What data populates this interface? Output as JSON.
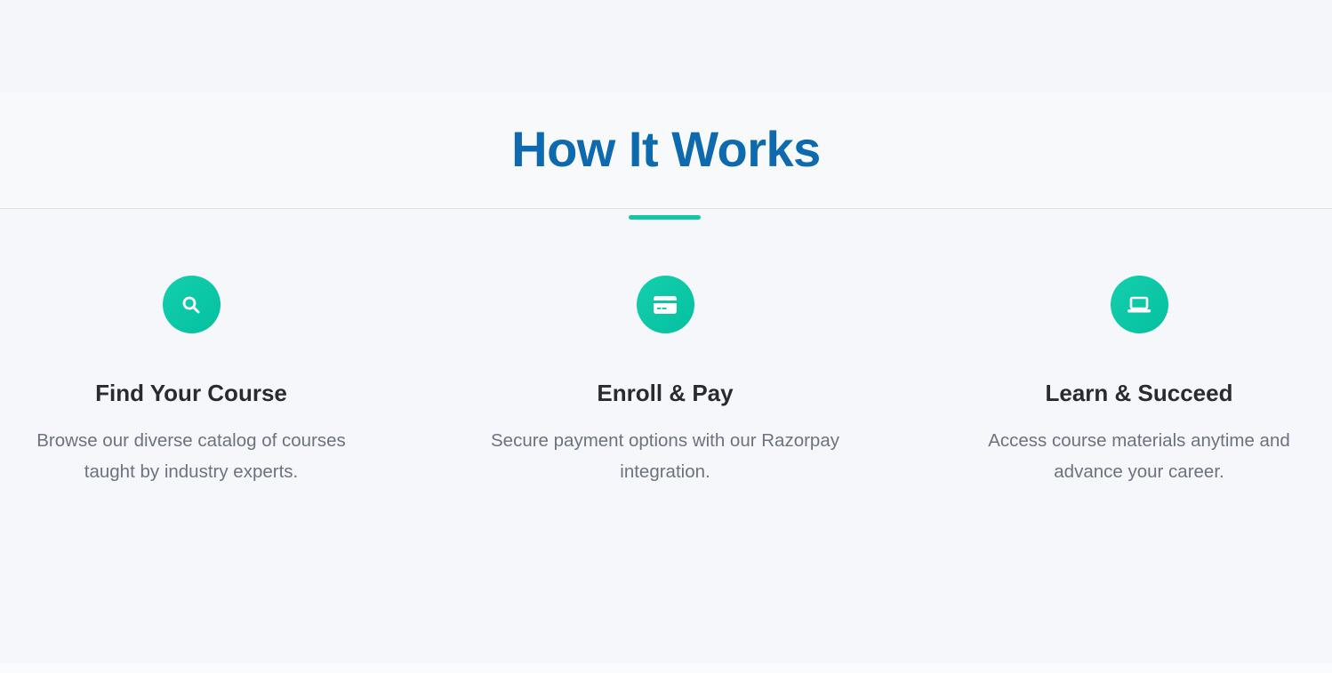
{
  "section": {
    "title": "How It Works"
  },
  "steps": [
    {
      "icon": "search-icon",
      "title": "Find Your Course",
      "description": "Browse our diverse catalog of courses taught by industry experts."
    },
    {
      "icon": "credit-card-icon",
      "title": "Enroll & Pay",
      "description": "Secure payment options with our Razorpay integration."
    },
    {
      "icon": "laptop-icon",
      "title": "Learn & Succeed",
      "description": "Access course materials anytime and advance your career."
    }
  ],
  "colors": {
    "title": "#0d6aae",
    "accent": "#10c8a5",
    "heading": "#2a2b2e",
    "body_text": "#6c7280",
    "background": "#f6f7fa"
  }
}
